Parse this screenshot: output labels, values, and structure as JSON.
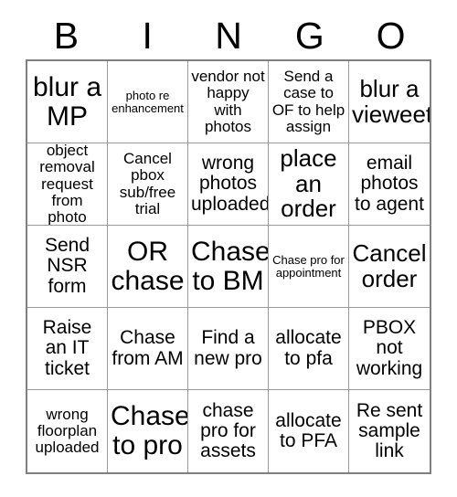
{
  "card": {
    "header_letters": [
      "B",
      "I",
      "N",
      "G",
      "O"
    ],
    "rows": [
      [
        {
          "text": "blur a MP",
          "size": "xl"
        },
        {
          "text": "photo re enhancement",
          "size": "xs"
        },
        {
          "text": "vendor not happy with photos",
          "size": "sm"
        },
        {
          "text": "Send a case to OF to help assign",
          "size": "sm"
        },
        {
          "text": "blur a vieweet",
          "size": "lg"
        }
      ],
      [
        {
          "text": "object removal request from photo",
          "size": "sm"
        },
        {
          "text": "Cancel pbox sub/free trial",
          "size": "sm"
        },
        {
          "text": "wrong photos uploaded",
          "size": "md"
        },
        {
          "text": "place an order",
          "size": "lg"
        },
        {
          "text": "email photos to agent",
          "size": "md"
        }
      ],
      [
        {
          "text": "Send NSR form",
          "size": "md"
        },
        {
          "text": "OR chase",
          "size": "xl"
        },
        {
          "text": "Chase to BM",
          "size": "xl"
        },
        {
          "text": "Chase pro for appointment",
          "size": "xs"
        },
        {
          "text": "Cancel order",
          "size": "lg"
        }
      ],
      [
        {
          "text": "Raise an IT ticket",
          "size": "md"
        },
        {
          "text": "Chase from AM",
          "size": "md"
        },
        {
          "text": "Find a new pro",
          "size": "md"
        },
        {
          "text": "allocate to pfa",
          "size": "md"
        },
        {
          "text": "PBOX not working",
          "size": "md"
        }
      ],
      [
        {
          "text": "wrong floorplan uploaded",
          "size": "sm"
        },
        {
          "text": "Chase to pro",
          "size": "xl"
        },
        {
          "text": "chase pro for assets",
          "size": "md"
        },
        {
          "text": "allocate to PFA",
          "size": "md"
        },
        {
          "text": "Re sent sample link",
          "size": "md"
        }
      ]
    ]
  }
}
